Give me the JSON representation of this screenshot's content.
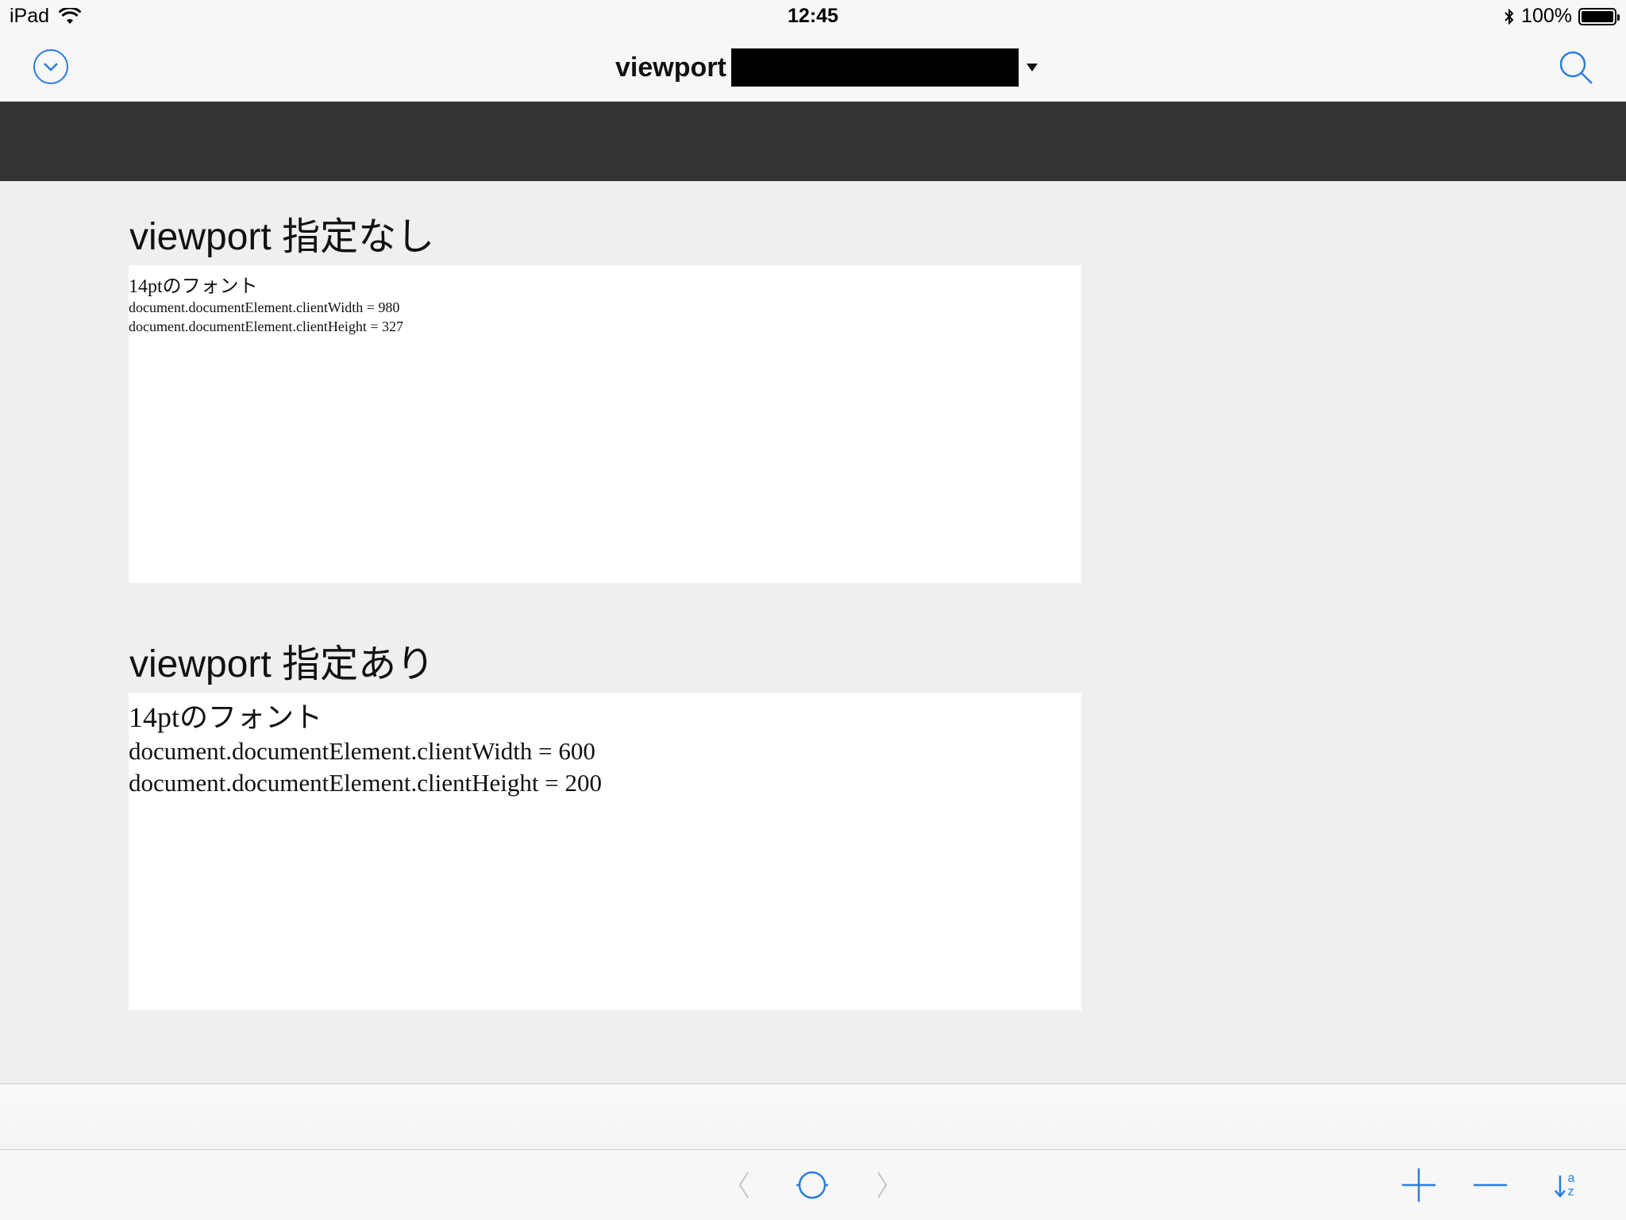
{
  "status_bar": {
    "device": "iPad",
    "time": "12:45",
    "battery_percent": "100%"
  },
  "nav": {
    "title": "viewport"
  },
  "sections": [
    {
      "title": "viewport 指定なし",
      "font_line": "14ptのフォント",
      "width_line": "document.documentElement.clientWidth = 980",
      "height_line": "document.documentElement.clientHeight = 327"
    },
    {
      "title": "viewport 指定あり",
      "font_line": "14ptのフォント",
      "width_line": "document.documentElement.clientWidth = 600",
      "height_line": "document.documentElement.clientHeight = 200"
    }
  ],
  "toolbar": {
    "sort_icon_top": "a",
    "sort_icon_bottom": "z"
  },
  "colors": {
    "accent": "#2a7de1",
    "dark_band": "#333333",
    "page_bg": "#efefef"
  }
}
